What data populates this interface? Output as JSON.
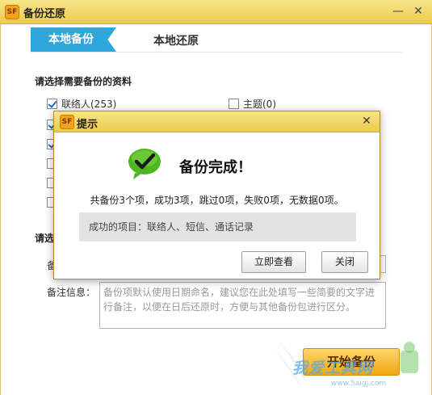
{
  "window": {
    "icon_text": "SF",
    "title": "备份还原",
    "minimize_glyph": "—",
    "close_glyph": "✕"
  },
  "tabs": [
    {
      "label": "本地备份",
      "active": true
    },
    {
      "label": "本地还原",
      "active": false
    }
  ],
  "backup_section": {
    "title": "请选择需要备份的资料",
    "items": [
      {
        "label": "联络人(253)",
        "checked": true
      },
      {
        "label": "主题(0)",
        "checked": false
      }
    ]
  },
  "settings_section": {
    "title_visible": "请选",
    "name_label_visible": "备",
    "note_label": "备注信息：",
    "note_placeholder": "备份项默认使用日期命名，建议您在此处填写一些简要的文字进行备注，以便在日后还原时，方便与其他备份包进行区分。"
  },
  "start_button": {
    "label": "开始备份"
  },
  "watermark": {
    "text": "我爱工具网",
    "url": "www.5aigj.com"
  },
  "dialog": {
    "icon_text": "SF",
    "title": "提示",
    "close_glyph": "✕",
    "success_title": "备份完成！",
    "summary": "共备份3个项，成功3项，跳过0项，失败0项，无数据0项。",
    "success_items": "成功的项目：联络人、短信、通话记录",
    "view_button": "立即查看",
    "close_button": "关闭"
  },
  "colors": {
    "titlebar": "#eccb4f",
    "tab_active": "#2ea7dd",
    "start_button": "#f2a712",
    "success_green": "#4fb520"
  }
}
